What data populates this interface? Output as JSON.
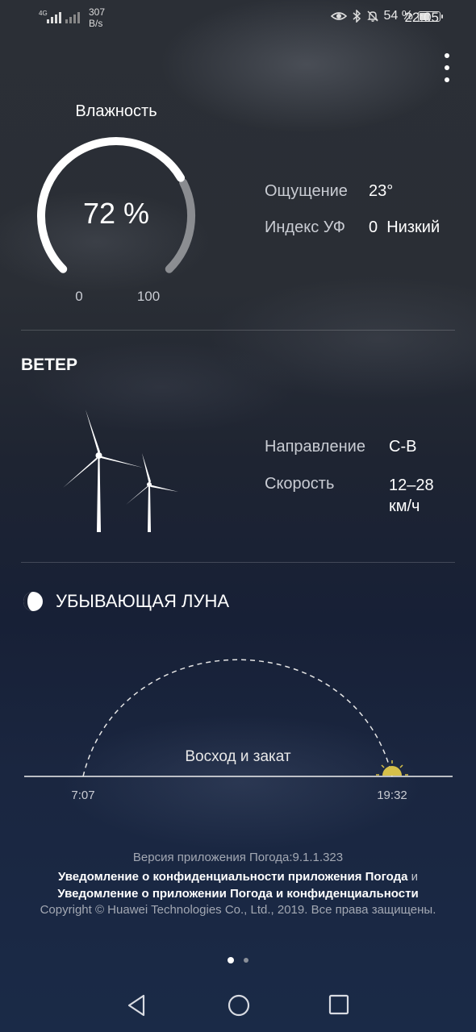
{
  "status_bar": {
    "network_type": "4G",
    "net_speed_value": "307",
    "net_speed_unit": "B/s",
    "battery_percent": "54 %",
    "battery_level": 0.54,
    "time": "22:05"
  },
  "humidity": {
    "title": "Влажность",
    "value_text": "72 %",
    "value": 72,
    "min_label": "0",
    "max_label": "100"
  },
  "conditions": [
    {
      "label": "Ощущение",
      "value": "23°"
    },
    {
      "label": "Индекс УФ",
      "value": "0  Низкий"
    }
  ],
  "wind": {
    "title": "ВЕТЕР",
    "direction_label": "Направление",
    "direction_value": "С-В",
    "speed_label": "Скорость",
    "speed_value_line1": "12–28",
    "speed_value_line2": "км/ч"
  },
  "moon": {
    "phase": "УБЫВАЮЩАЯ ЛУНА",
    "icon": "waning-moon-icon"
  },
  "sun": {
    "title": "Восход и закат",
    "sunrise": "7:07",
    "sunset": "19:32",
    "icon": "setting-sun-icon",
    "sun_color": "#d6c04a"
  },
  "footer": {
    "version": "Версия приложения Погода:9.1.1.323",
    "privacy_link_1": "Уведомление о конфиденциальности приложения Погода",
    "conjunction": "и",
    "privacy_link_2": "Уведомление о приложении Погода и конфиденциальности",
    "copyright": "Copyright © Huawei Technologies Co., Ltd., 2019. Все права защищены."
  },
  "pager": {
    "count": 2,
    "active": 1
  },
  "navigation": {
    "back_icon": "triangle-back-icon",
    "home_icon": "circle-home-icon",
    "recents_icon": "square-recents-icon"
  }
}
